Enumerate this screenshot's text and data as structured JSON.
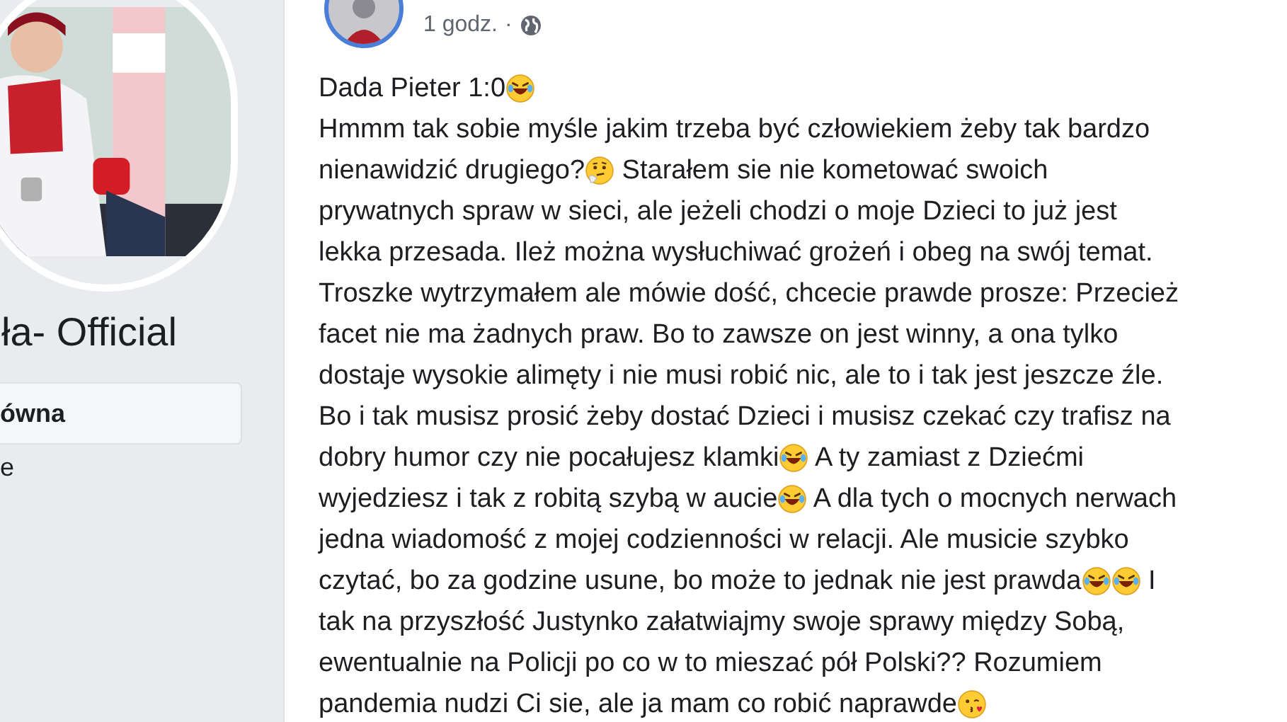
{
  "sidebar": {
    "page_name": "ła- Official",
    "nav_items": [
      {
        "label": "ówna",
        "selected": true
      },
      {
        "label": "e",
        "selected": false
      }
    ]
  },
  "post": {
    "time": "1 godz.",
    "separator": "·",
    "lines": [
      [
        {
          "kind": "text",
          "text": "Dada Pieter 1:0"
        },
        {
          "kind": "laugh_emoji"
        }
      ],
      [
        {
          "kind": "text",
          "text": "Hmmm tak sobie myśle jakim trzeba być człowiekiem żeby tak bardzo"
        }
      ],
      [
        {
          "kind": "text",
          "text": "nienawidzić drugiego?"
        },
        {
          "kind": "thinking_emoji"
        },
        {
          "kind": "text",
          "text": " Starałem sie nie kometować swoich"
        }
      ],
      [
        {
          "kind": "text",
          "text": "prywatnych spraw w sieci, ale jeżeli chodzi o moje Dzieci to już jest"
        }
      ],
      [
        {
          "kind": "text",
          "text": "lekka przesada. Ileż można wysłuchiwać grożeń i obeg na swój temat."
        }
      ],
      [
        {
          "kind": "text",
          "text": "Troszke wytrzymałem ale mówie dość, chcecie prawde prosze: Przecież"
        }
      ],
      [
        {
          "kind": "text",
          "text": "facet nie ma żadnych praw. Bo to zawsze on jest winny, a ona tylko"
        }
      ],
      [
        {
          "kind": "text",
          "text": "dostaje wysokie alimęty i nie musi robić nic, ale to i tak jest jeszcze źle."
        }
      ],
      [
        {
          "kind": "text",
          "text": "Bo i tak musisz prosić żeby dostać Dzieci i musisz czekać czy trafisz na"
        }
      ],
      [
        {
          "kind": "text",
          "text": "dobry humor czy nie pocałujesz klamki"
        },
        {
          "kind": "laugh_emoji"
        },
        {
          "kind": "text",
          "text": " A ty zamiast z Dziećmi"
        }
      ],
      [
        {
          "kind": "text",
          "text": "wyjedziesz i tak z robitą szybą w aucie"
        },
        {
          "kind": "laugh_emoji"
        },
        {
          "kind": "text",
          "text": " A dla tych o mocnych nerwach"
        }
      ],
      [
        {
          "kind": "text",
          "text": "jedna wiadomość z mojej codzienności w relacji. Ale musicie szybko"
        }
      ],
      [
        {
          "kind": "text",
          "text": "czytać, bo za godzine usune, bo może to jednak nie jest prawda"
        },
        {
          "kind": "laugh_emoji"
        },
        {
          "kind": "laugh_emoji"
        },
        {
          "kind": "text",
          "text": " I"
        }
      ],
      [
        {
          "kind": "text",
          "text": "tak na przyszłość Justynko załatwiajmy swoje sprawy między Sobą,"
        }
      ],
      [
        {
          "kind": "text",
          "text": "ewentualnie na Policji po co w to mieszać pół Polski?? Rozumiem"
        }
      ],
      [
        {
          "kind": "text",
          "text": "pandemia nudzi Ci sie, ale ja mam co robić naprawde"
        },
        {
          "kind": "kiss_emoji"
        }
      ]
    ]
  }
}
